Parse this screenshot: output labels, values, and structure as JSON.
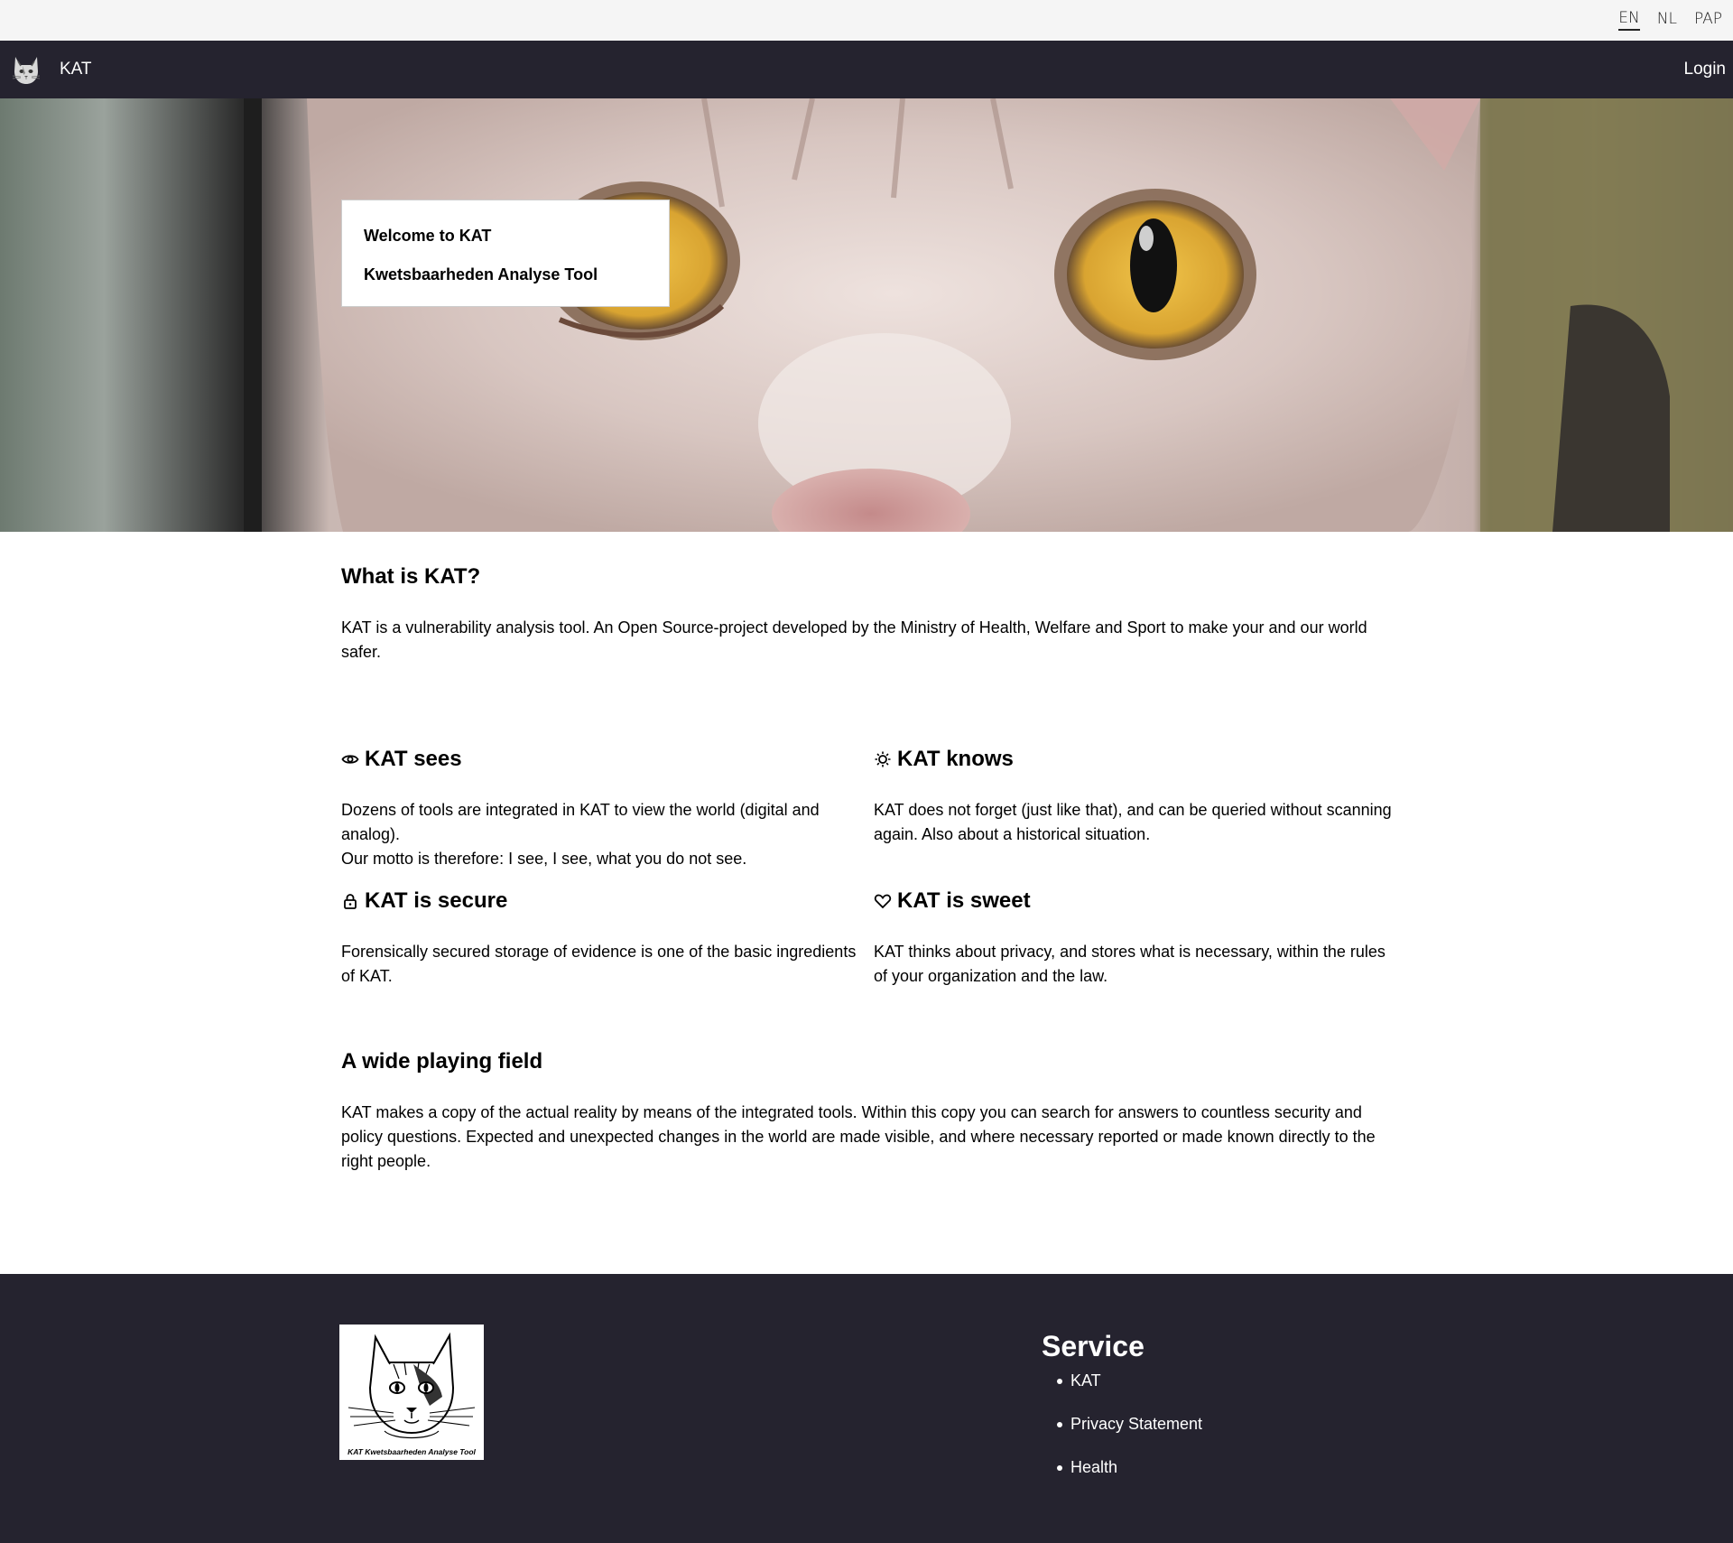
{
  "languages": [
    "EN",
    "NL",
    "PAP"
  ],
  "active_language": "EN",
  "nav": {
    "brand": "KAT",
    "login": "Login"
  },
  "hero": {
    "welcome_title": "Welcome to KAT",
    "welcome_subtitle": "Kwetsbaarheden Analyse Tool"
  },
  "intro": {
    "heading": "What is KAT?",
    "text": "KAT is a vulnerability analysis tool. An Open Source-project developed by the Ministry of Health, Welfare and Sport to make your and our world safer."
  },
  "features": [
    {
      "icon": "eye-icon",
      "title": "KAT sees",
      "text_line1": "Dozens of tools are integrated in KAT to view the world (digital and analog).",
      "text_line2": "Our motto is therefore: I see, I see, what you do not see."
    },
    {
      "icon": "lightbulb-icon",
      "title": "KAT knows",
      "text_line1": "KAT does not forget (just like that), and can be queried without scanning again. Also about a historical situation.",
      "text_line2": ""
    },
    {
      "icon": "lock-icon",
      "title": "KAT is secure",
      "text_line1": "Forensically secured storage of evidence is one of the basic ingredients of KAT.",
      "text_line2": ""
    },
    {
      "icon": "heart-icon",
      "title": "KAT is sweet",
      "text_line1": "KAT thinks about privacy, and stores what is necessary, within the rules of your organization and the law.",
      "text_line2": ""
    }
  ],
  "playing_field": {
    "heading": "A wide playing field",
    "text": "KAT makes a copy of the actual reality by means of the integrated tools. Within this copy you can search for answers to countless security and policy questions. Expected and unexpected changes in the world are made visible, and where necessary reported or made known directly to the right people."
  },
  "footer": {
    "logo_caption": "KAT Kwetsbaarheden Analyse Tool",
    "service_heading": "Service",
    "service_links": [
      "KAT",
      "Privacy Statement",
      "Health"
    ]
  },
  "colors": {
    "nav_bg": "#25232f",
    "lang_bar_bg": "#f5f5f5",
    "footer_bg": "#25232f"
  }
}
